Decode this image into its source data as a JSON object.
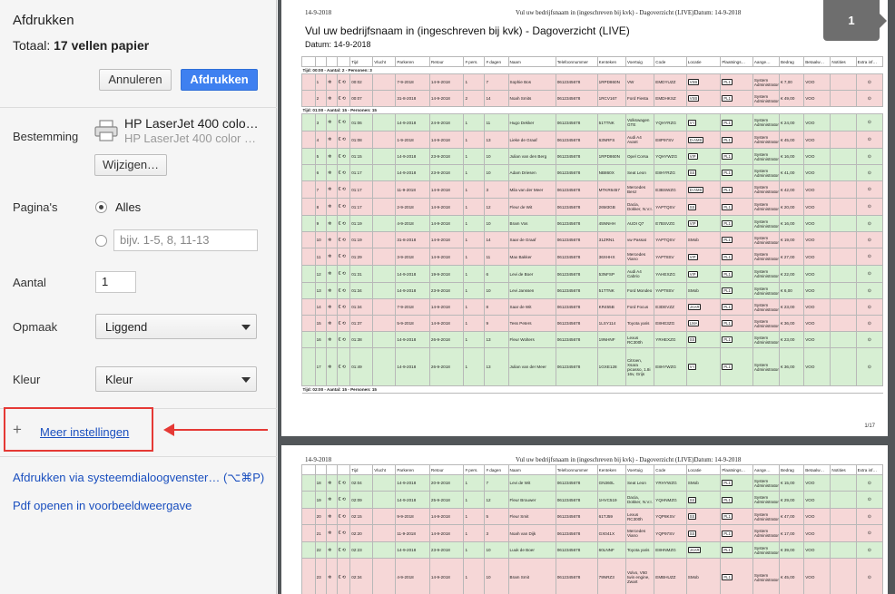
{
  "panel": {
    "title": "Afdrukken",
    "total_prefix": "Totaal:",
    "total_value": "17 vellen papier",
    "cancel": "Annuleren",
    "print": "Afdrukken",
    "destination_label": "Bestemming",
    "printer_name": "HP LaserJet 400 colo…",
    "printer_name2": "HP LaserJet 400 color …",
    "change": "Wijzigen…",
    "pages_label": "Pagina's",
    "pages_all": "Alles",
    "pages_placeholder": "bijv. 1-5, 8, 11-13",
    "copies_label": "Aantal",
    "copies_value": "1",
    "layout_label": "Opmaak",
    "layout_value": "Liggend",
    "color_label": "Kleur",
    "color_value": "Kleur",
    "more_settings": "Meer instellingen",
    "system_dialog": "Afdrukken via systeemdialoogvenster… (⌥⌘P)",
    "open_pdf": "Pdf openen in voorbeeldweergave"
  },
  "preview": {
    "page_badge": "1",
    "header_date": "14-9-2018",
    "header_center": "Vul uw bedrijfsnaam in (ingeschreven bij kvk) - Dagoverzicht (LIVE)Datum: 14-9-2018",
    "doc_title": "Vul uw bedrijfsnaam in (ingeschreven bij kvk) - Dagoverzicht (LIVE)",
    "doc_date": "Datum: 14-9-2018",
    "page_number": "1/17",
    "columns": [
      "",
      "",
      "",
      "",
      "Tijd",
      "Vlucht",
      "Parkeren",
      "Retour",
      "# pers.",
      "# dagen",
      "Naam",
      "Telefoonnummer",
      "Kenteken",
      "Voertuig",
      "Code",
      "Locatie",
      "Plaatsings…",
      "Aange…",
      "Bedrag",
      "Betaalw…",
      "Notities",
      "Extra inf…"
    ],
    "groups": [
      {
        "label": "Tijd: 00:00 - Aantal: 2 - Personen: 3",
        "type": "start"
      },
      {
        "label": "Tijd: 01:00 - Aantal: 15 - Personen: 15",
        "type": "start"
      },
      {
        "label": "Tijd: 02:00 - Aantal: 15 - Personen: 15",
        "type": "end"
      }
    ],
    "rows_page1": [
      {
        "g": 0,
        "c": "red",
        "n": "1",
        "t": "00:02",
        "p": "7-9-2018",
        "r": "14-9-2018",
        "pers": "1",
        "d": "7",
        "name": "Sophie Bos",
        "tel": "0612345678",
        "k": "1RPD860N",
        "v": "VW",
        "code": "EMDYUZZ",
        "loc": "VSB",
        "pl": "PL1",
        "a": "System Administrator",
        "b": "€ 7,00",
        "bw": "VOO"
      },
      {
        "g": 0,
        "c": "red",
        "n": "2",
        "t": "00:07",
        "p": "31-8-2018",
        "r": "14-9-2018",
        "pers": "2",
        "d": "14",
        "name": "Noah Smits",
        "tel": "0612345678",
        "k": "1RCV167",
        "v": "Ford Fiesta",
        "code": "EMDHKSZ",
        "loc": "VSB",
        "pl": "PL1",
        "a": "System Administrator",
        "b": "€ 49,00",
        "bw": "VOO"
      },
      {
        "g": 1,
        "c": "grn",
        "n": "3",
        "t": "01:06",
        "p": "14-9-2018",
        "r": "24-9-2018",
        "pers": "1",
        "d": "11",
        "name": "Hugo Dekker",
        "tel": "0612345678",
        "k": "51TTNK",
        "v": "Volkswagen GTE",
        "code": "YQHYRZG",
        "loc": "V-I",
        "pl": "PL1",
        "a": "System Administrator",
        "b": "€ 24,00",
        "bw": "VOO"
      },
      {
        "g": 1,
        "c": "red",
        "n": "4",
        "t": "01:08",
        "p": "1-9-2018",
        "r": "14-9-2018",
        "pers": "1",
        "d": "13",
        "name": "Lieke de Graaf",
        "tel": "0612345678",
        "k": "63NRFS",
        "v": "Audi A4 Avant",
        "code": "E8P97SV",
        "loc": "D-AMS",
        "pl": "PL1",
        "a": "System Administrator",
        "b": "€ 45,00",
        "bw": "VOO"
      },
      {
        "g": 1,
        "c": "grn",
        "n": "5",
        "t": "01:15",
        "p": "14-9-2018",
        "r": "23-9-2018",
        "pers": "1",
        "d": "10",
        "name": "Julian van den Berg",
        "tel": "0612345678",
        "k": "1RPD860N",
        "v": "Opel Corsa",
        "code": "YQHYWZG",
        "loc": "VIP",
        "pl": "PL1",
        "a": "System Administrator",
        "b": "€ 16,00",
        "bw": "VOO"
      },
      {
        "g": 1,
        "c": "grn",
        "n": "6",
        "t": "01:17",
        "p": "14-9-2018",
        "r": "23-9-2018",
        "pers": "1",
        "d": "10",
        "name": "Adam Driesen",
        "tel": "0612345678",
        "k": "NB860X",
        "v": "Seat Leon",
        "code": "E8HYRZG",
        "loc": "SS",
        "pl": "PL1",
        "a": "System Administrator",
        "b": "€ 41,00",
        "bw": "VOO"
      },
      {
        "g": 1,
        "c": "red",
        "n": "7",
        "t": "01:17",
        "p": "11-9-2018",
        "r": "14-9-2018",
        "pers": "1",
        "d": "3",
        "name": "Mila van der Meer",
        "tel": "0612345678",
        "k": "MTKR6457",
        "v": "Mercedes Benz",
        "code": "E3BSWZG",
        "loc": "D-AMS",
        "pl": "PL1",
        "a": "System Administrator",
        "b": "€ 42,00",
        "bw": "VOO"
      },
      {
        "g": 1,
        "c": "red",
        "n": "8",
        "t": "01:17",
        "p": "2-9-2018",
        "r": "14-9-2018",
        "pers": "1",
        "d": "12",
        "name": "Fleur de Wit",
        "tel": "0612345678",
        "k": "26M3GB",
        "v": "Dacia, Dokker, N.V.I.",
        "code": "YAPTQSV",
        "loc": "SS",
        "pl": "PL1",
        "a": "System Administrator",
        "b": "€ 20,00",
        "bw": "VOO"
      },
      {
        "g": 1,
        "c": "grn",
        "n": "9",
        "t": "01:19",
        "p": "4-9-2018",
        "r": "14-9-2018",
        "pers": "1",
        "d": "10",
        "name": "Bram Vos",
        "tel": "0612345678",
        "k": "45NNHH",
        "v": "AUDI Q7",
        "code": "E7BSVZG",
        "loc": "VIP",
        "pl": "PL1",
        "a": "System Administrator",
        "b": "€ 16,00",
        "bw": "VOO"
      },
      {
        "g": 1,
        "c": "red",
        "n": "10",
        "t": "01:19",
        "p": "31-8-2018",
        "r": "14-9-2018",
        "pers": "1",
        "d": "14",
        "name": "Saar de Graaf",
        "tel": "0612345678",
        "k": "31ZRN1",
        "v": "vw Passat",
        "code": "YAPTQSV",
        "loc": "SMob",
        "pl": "PL1",
        "a": "System Administrator",
        "b": "€ 19,00",
        "bw": "VOO"
      },
      {
        "g": 1,
        "c": "red",
        "n": "11",
        "t": "01:29",
        "p": "3-9-2018",
        "r": "14-9-2018",
        "pers": "1",
        "d": "11",
        "name": "Max Bakker",
        "tel": "0612345678",
        "k": "36XHHX",
        "v": "Mercedes Viano",
        "code": "YAPT8SV",
        "loc": "VIP",
        "pl": "PL1",
        "a": "System Administrator",
        "b": "€ 27,00",
        "bw": "VOO"
      },
      {
        "g": 1,
        "c": "grn",
        "n": "12",
        "t": "01:31",
        "p": "14-9-2018",
        "r": "19-9-2018",
        "pers": "1",
        "d": "6",
        "name": "Levi de Boer",
        "tel": "0612345678",
        "k": "53NFSP",
        "v": "Audi A4 Cabrio",
        "code": "YAHEXZG",
        "loc": "VIP",
        "pl": "PL1",
        "a": "System Administrator",
        "b": "€ 22,00",
        "bw": "VOO"
      },
      {
        "g": 1,
        "c": "grn",
        "n": "13",
        "t": "01:34",
        "p": "14-9-2018",
        "r": "23-9-2018",
        "pers": "1",
        "d": "10",
        "name": "Levi Janssen",
        "tel": "0612345678",
        "k": "51TTNK",
        "v": "Ford Mondeo",
        "code": "YAPT8SV",
        "loc": "SMob",
        "pl": "PL1",
        "a": "System Administrator",
        "b": "€ 6,00",
        "bw": "VOO"
      },
      {
        "g": 1,
        "c": "red",
        "n": "14",
        "t": "01:34",
        "p": "7-9-2018",
        "r": "14-9-2018",
        "pers": "1",
        "d": "8",
        "name": "Saar de Wit",
        "tel": "0612345678",
        "k": "KR455B",
        "v": "Ford Focus",
        "code": "E3DEVZZ",
        "loc": "JAAR",
        "pl": "PL1",
        "a": "System Administrator",
        "b": "€ 23,00",
        "bw": "VOO"
      },
      {
        "g": 1,
        "c": "red",
        "n": "15",
        "t": "01:37",
        "p": "5-9-2018",
        "r": "14-9-2018",
        "pers": "1",
        "d": "9",
        "name": "Tess Peters",
        "tel": "0612345678",
        "k": "1LSY114",
        "v": "Toyota yaris",
        "code": "E8HE3ZG",
        "loc": "LMA",
        "pl": "PL1",
        "a": "System Administrator",
        "b": "€ 36,00",
        "bw": "VOO"
      },
      {
        "g": 1,
        "c": "grn",
        "n": "16",
        "t": "01:38",
        "p": "14-9-2018",
        "r": "26-9-2018",
        "pers": "1",
        "d": "13",
        "name": "Fleur Wolters",
        "tel": "0612345678",
        "k": "19NHNF",
        "v": "Lexus RC300h",
        "code": "YRHEXZG",
        "loc": "SS",
        "pl": "PL1",
        "a": "System Administrator",
        "b": "€ 23,00",
        "bw": "VOO"
      },
      {
        "g": 1,
        "c": "grn",
        "n": "17",
        "t": "01:49",
        "p": "14-9-2018",
        "r": "26-9-2018",
        "pers": "1",
        "d": "13",
        "name": "Julian van der Meer",
        "tel": "0612345678",
        "k": "1GXE128",
        "v": "Citroen, Xsara picasso, 1.8i 16v, Grijs",
        "code": "E8HYWZG",
        "loc": "V-I",
        "pl": "PL1",
        "a": "System Administrator",
        "b": "€ 36,00",
        "bw": "VOO"
      }
    ],
    "rows_page2": [
      {
        "c": "grn",
        "n": "18",
        "t": "02:04",
        "p": "14-9-2018",
        "r": "20-9-2018",
        "pers": "1",
        "d": "7",
        "name": "Levi de Wit",
        "tel": "0612345678",
        "k": "GN360L",
        "v": "Seat Leon",
        "code": "YRHYWZG",
        "loc": "SMob",
        "pl": "PL1",
        "a": "System Administrator",
        "b": "€ 15,00",
        "bw": "VOO"
      },
      {
        "c": "grn",
        "n": "19",
        "t": "02:09",
        "p": "14-9-2018",
        "r": "25-9-2018",
        "pers": "1",
        "d": "12",
        "name": "Fleur Brouwer",
        "tel": "0612345678",
        "k": "1HVC519",
        "v": "Dacia, Dokker, N.V.I.",
        "code": "YQHNMZG",
        "loc": "SS",
        "pl": "PL1",
        "a": "System Administrator",
        "b": "€ 29,00",
        "bw": "VOO"
      },
      {
        "c": "red",
        "n": "20",
        "t": "02:15",
        "p": "9-9-2018",
        "r": "14-9-2018",
        "pers": "1",
        "d": "5",
        "name": "Fleur Smit",
        "tel": "0612345678",
        "k": "61TJ59",
        "v": "Lexus RC300h",
        "code": "YQP8KSV",
        "loc": "SS",
        "pl": "PL1",
        "a": "System Administrator",
        "b": "€ 47,00",
        "bw": "VOO"
      },
      {
        "c": "red",
        "n": "21",
        "t": "02:20",
        "p": "11-9-2018",
        "r": "14-9-2018",
        "pers": "1",
        "d": "3",
        "name": "Noah van Dijk",
        "tel": "0612345678",
        "k": "GX041X",
        "v": "Mercedes Viano",
        "code": "YQP97SV",
        "loc": "SS",
        "pl": "PL1",
        "a": "System Administrator",
        "b": "€ 17,00",
        "bw": "VOO"
      },
      {
        "c": "grn",
        "n": "22",
        "t": "02:23",
        "p": "14-9-2018",
        "r": "23-9-2018",
        "pers": "1",
        "d": "10",
        "name": "Luuk de Boer",
        "tel": "0612345678",
        "k": "60LNNF",
        "v": "Toyota yaris",
        "code": "E8HNMZG",
        "loc": "JAAR",
        "pl": "PL1",
        "a": "System Administrator",
        "b": "€ 39,00",
        "bw": "VOO"
      },
      {
        "c": "red",
        "n": "23",
        "t": "02:34",
        "p": "4-9-2018",
        "r": "14-9-2018",
        "pers": "1",
        "d": "10",
        "name": "Bram Smit",
        "tel": "0612345678",
        "k": "79NRZ3",
        "v": "Volvo, V60 twin engine, Zwart",
        "code": "EMBHUZZ",
        "loc": "SMob",
        "pl": "PL1",
        "a": "System Administrator",
        "b": "€ 45,00",
        "bw": "VOO"
      }
    ]
  }
}
